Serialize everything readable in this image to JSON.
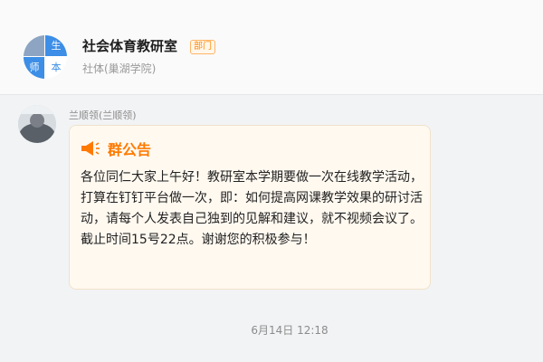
{
  "group": {
    "avatar_chars": [
      "",
      "生",
      "师",
      "本"
    ],
    "name": "社会体育教研室",
    "tag": "部门",
    "subtitle": "社体(巢湖学院)"
  },
  "message": {
    "sender": "兰顺领(兰顺领)",
    "title": "群公告",
    "icon": "megaphone-icon",
    "body": "各位同仁大家上午好！教研室本学期要做一次在线教学活动，打算在钉钉平台做一次，即：如何提高网课教学效果的研讨活动，请每个人发表自己独到的见解和建议，就不视频会议了。截止时间15号22点。谢谢您的积极参与！"
  },
  "timestamp": "6月14日 12:18",
  "colors": {
    "accent": "#ff7a00",
    "bubble_bg": "#fff9f0",
    "avatar_blue": "#3c8ee6"
  }
}
